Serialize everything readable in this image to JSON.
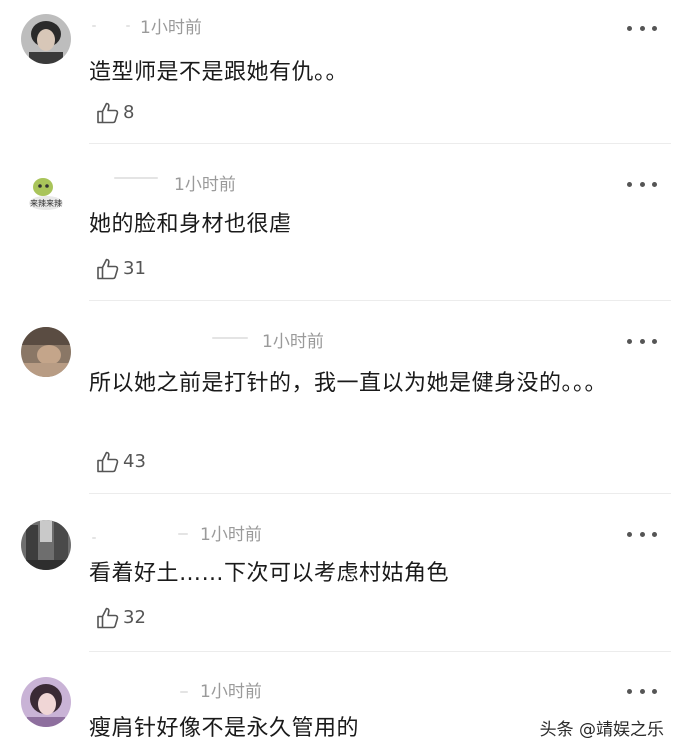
{
  "comments": [
    {
      "avatar": "avatar-dark-hair-icon",
      "time": "1小时前",
      "text": "造型师是不是跟她有仇。。",
      "likes": "8"
    },
    {
      "avatar": "avatar-green-cartoon-icon",
      "avatar_label": "来辣来辣",
      "time": "1小时前",
      "text": "她的脸和身材也很虐",
      "likes": "31"
    },
    {
      "avatar": "avatar-brown-photo-icon",
      "time": "1小时前",
      "text": "所以她之前是打针的，我一直以为她是健身没的。。。",
      "likes": "43"
    },
    {
      "avatar": "avatar-street-photo-icon",
      "time": "1小时前",
      "text": "看着好土……下次可以考虑村姑角色",
      "likes": "32"
    },
    {
      "avatar": "avatar-girl-photo-icon",
      "time": "1小时前",
      "text": "瘦肩针好像不是永久管用的"
    }
  ],
  "icons": {
    "like": "thumbs-up-icon",
    "more": "more-dots-icon"
  },
  "watermark": "头条 @靖娱之乐",
  "colors": {
    "text": "#1a1a1a",
    "meta": "#9a9a9a",
    "divider": "#ececec"
  }
}
